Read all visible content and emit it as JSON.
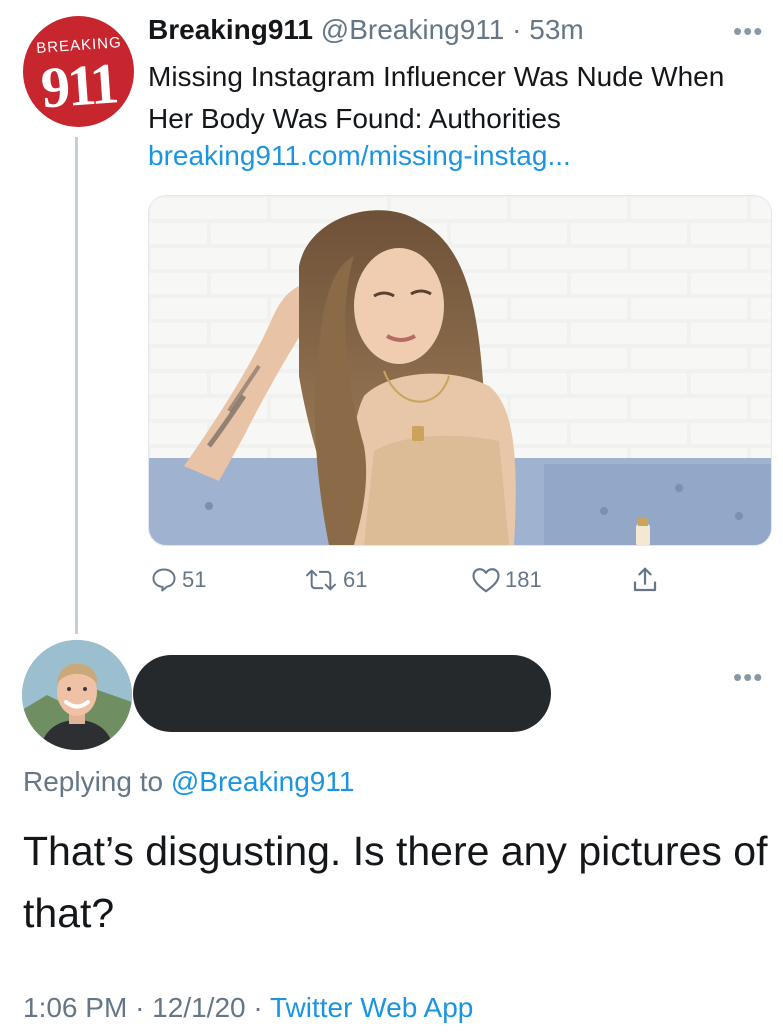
{
  "tweet": {
    "avatar": {
      "brand_top": "BREAKING",
      "brand_bottom": "911",
      "color": "#c8262e"
    },
    "display_name": "Breaking911",
    "handle": "@Breaking911",
    "separator": "·",
    "time_ago": "53m",
    "more_icon": "more-horizontal-icon",
    "more_label": "•••",
    "text": "Missing Instagram Influencer Was Nude When Her Body Was Found: Authorities",
    "link": "breaking911.com/missing-instag...",
    "actions": {
      "reply_count": "51",
      "retweet_count": "61",
      "like_count": "181",
      "reply_icon": "comment-icon",
      "retweet_icon": "retweet-icon",
      "like_icon": "heart-icon",
      "share_icon": "share-icon"
    }
  },
  "reply": {
    "more_label": "•••",
    "replying_prefix": "Replying to",
    "replying_handle": "@Breaking911",
    "text": "That’s disgusting. Is there any pictures of that?",
    "time": "1:06 PM",
    "separator": "·",
    "date": "12/1/20",
    "source": "Twitter Web App"
  },
  "colors": {
    "link": "#1b95e0",
    "muted": "#657786",
    "thread_line": "#c4cfd6",
    "redaction": "#25292c"
  }
}
